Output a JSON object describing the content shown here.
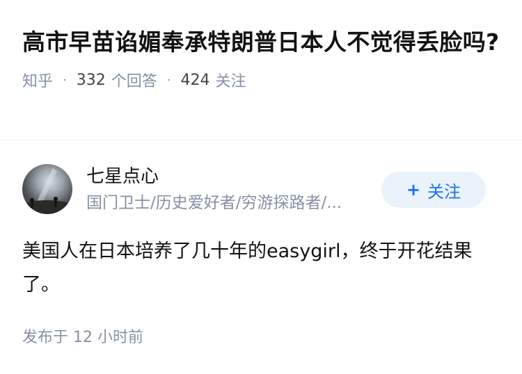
{
  "question": {
    "title": "高市早苗谄媚奉承特朗普日本人不觉得丢脸吗?",
    "source": "知乎",
    "answers_count": "332",
    "answers_label": "个回答",
    "follows_count": "424",
    "follows_label": "关注"
  },
  "answer": {
    "author_name": "七星点心",
    "author_bio": "国门卫士/历史爱好者/穷游探路者/...",
    "follow_button_label": "关注",
    "follow_icon": "plus-icon",
    "content": "美国人在日本培养了几十年的easygirl，终于开花结果了。",
    "published": "发布于 12 小时前"
  },
  "colors": {
    "accent": "#1772f6",
    "muted": "#8590a6",
    "follow_bg": "#eaf2fc"
  }
}
